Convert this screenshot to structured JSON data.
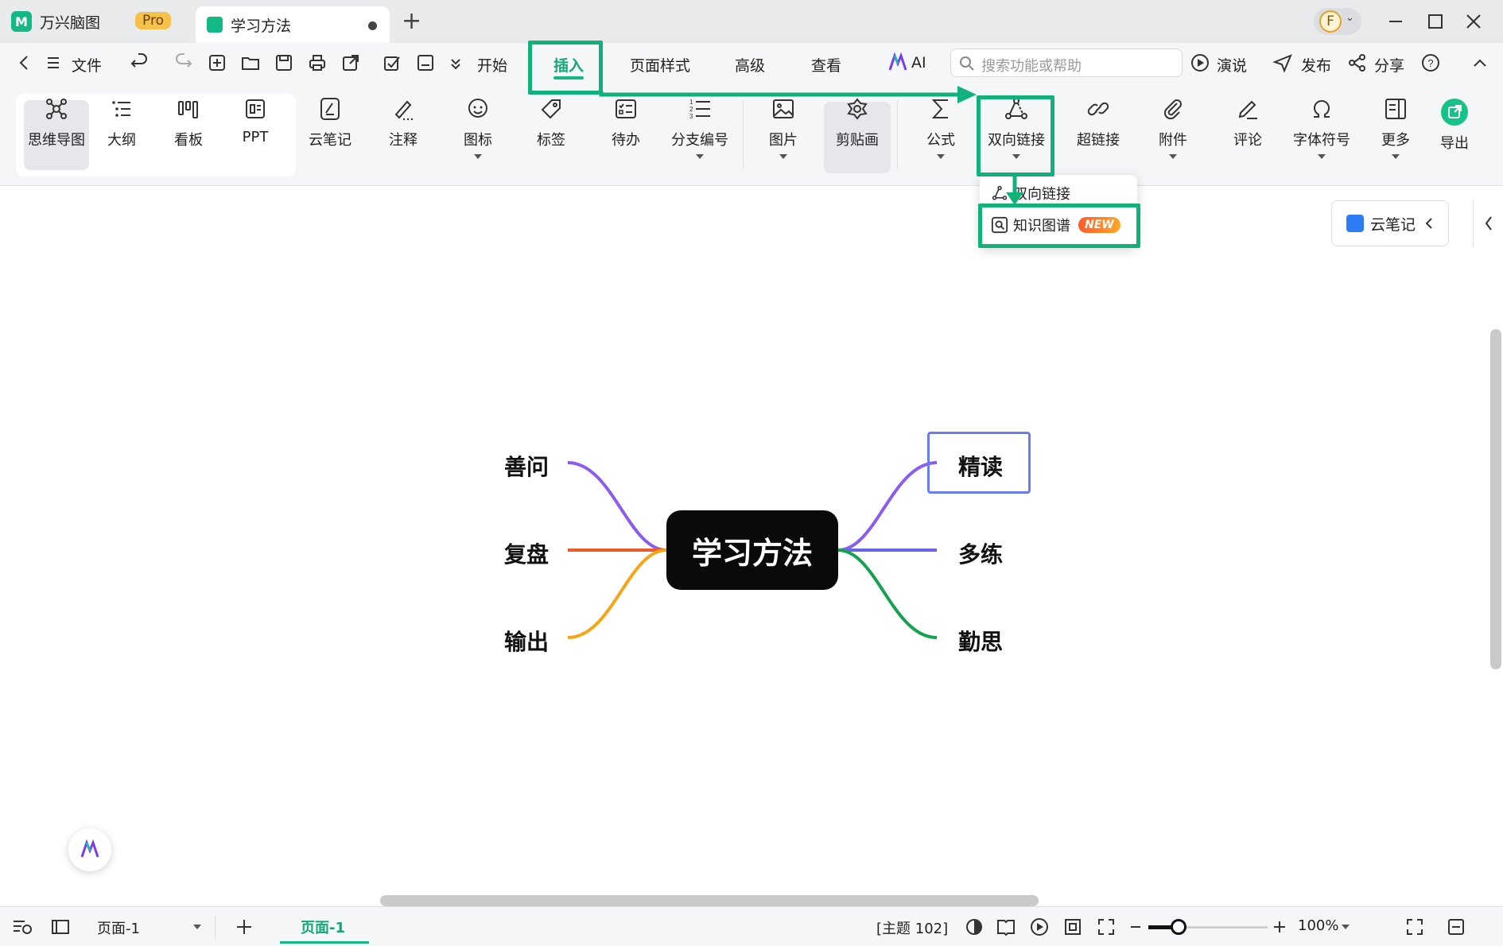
{
  "titlebar": {
    "app_name": "万兴脑图",
    "pro_badge": "Pro",
    "doc_tab": "学习方法",
    "avatar_letter": "F"
  },
  "menubar": {
    "file": "文件",
    "tabs": [
      "开始",
      "插入",
      "页面样式",
      "高级",
      "查看"
    ],
    "active_tab": "插入",
    "ai_label": "AI",
    "search_placeholder": "搜索功能或帮助",
    "present": "演说",
    "publish": "发布",
    "share": "分享"
  },
  "ribbon": {
    "views": [
      "思维导图",
      "大纲",
      "看板",
      "PPT"
    ],
    "tools": [
      "云笔记",
      "注释",
      "图标",
      "标签",
      "待办",
      "分支编号",
      "图片",
      "剪贴画",
      "公式",
      "双向链接",
      "超链接",
      "附件",
      "评论",
      "字体符号",
      "更多",
      "导出"
    ]
  },
  "dropdown": {
    "items": [
      "双向链接",
      "知识图谱"
    ],
    "new_badge": "NEW"
  },
  "side_panel": {
    "cloud_note_button": "云笔记"
  },
  "mindmap": {
    "central": "学习方法",
    "left_branches": [
      "善问",
      "复盘",
      "输出"
    ],
    "right_branches": [
      "精读",
      "多练",
      "勤思"
    ],
    "selected_node": "精读",
    "branch_colors": {
      "善问": "#8a5cf0",
      "复盘": "#f2592a",
      "输出": "#f5a516",
      "精读": "#8a5cf0",
      "多练": "#6a63f0",
      "勤思": "#14a24e"
    }
  },
  "statusbar": {
    "page_select": "页面-1",
    "page_tab": "页面-1",
    "topic_count": "[主题 102]",
    "zoom": "100%",
    "zoom_slider_fraction": 0.25
  },
  "colors": {
    "accent": "#14b887",
    "highlight_box": "#12b07a"
  }
}
